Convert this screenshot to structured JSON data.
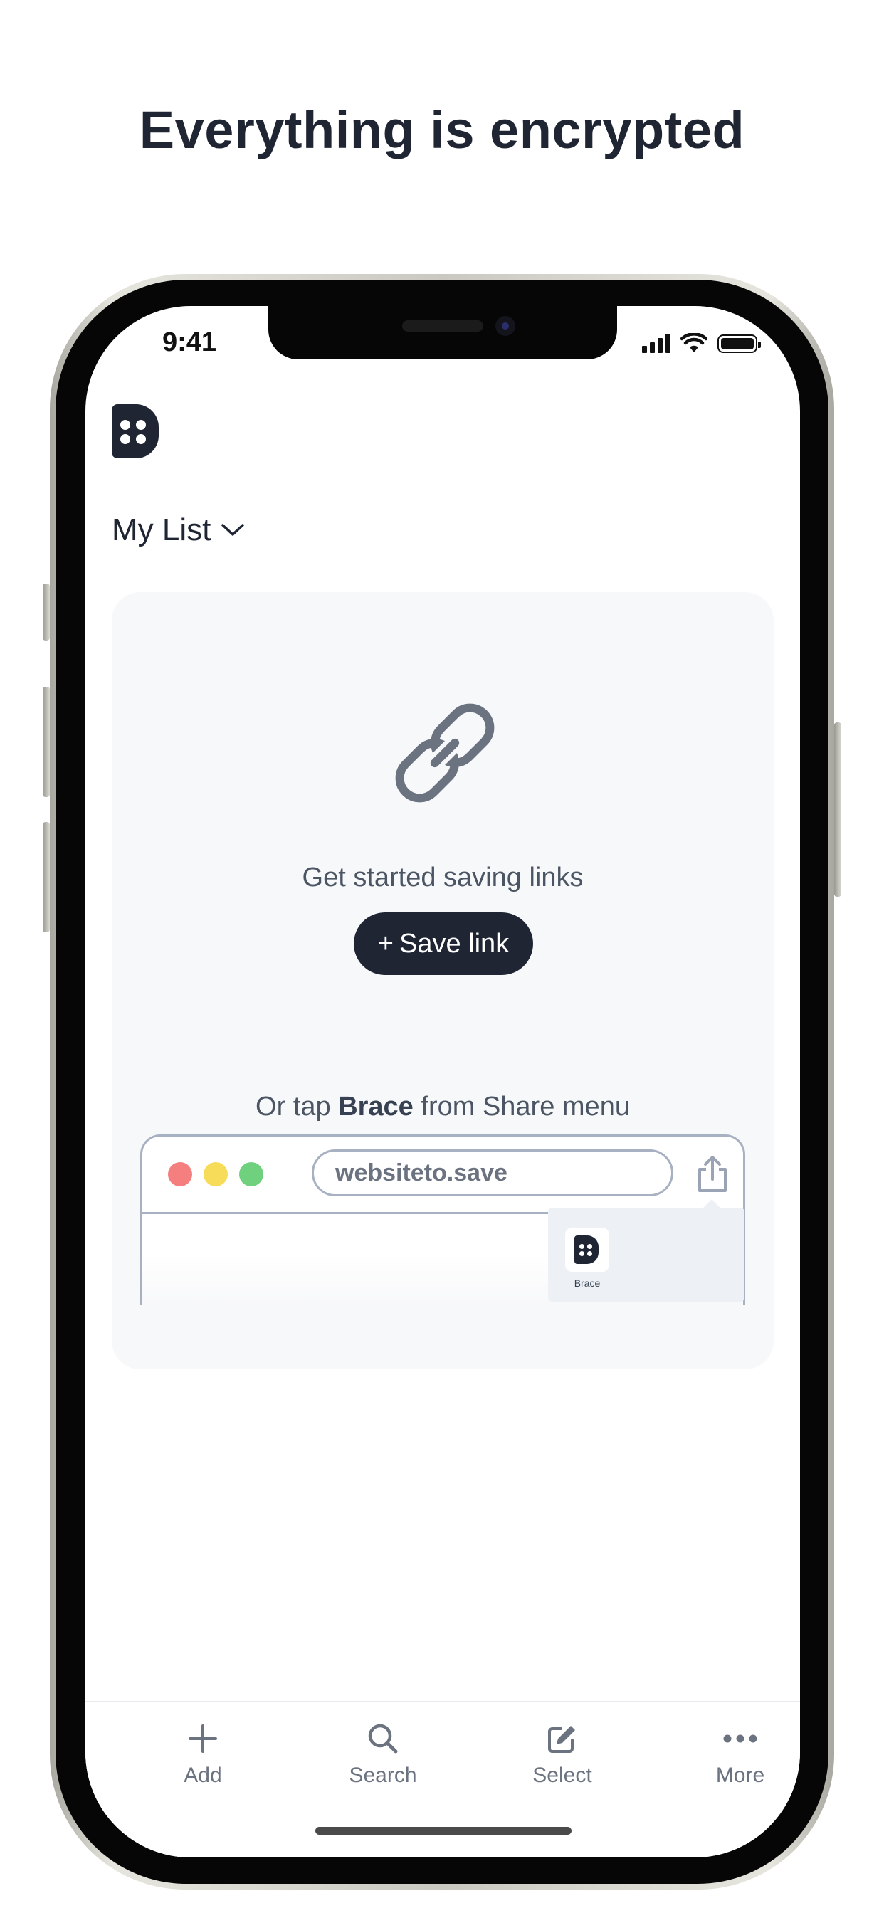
{
  "headline": "Everything is encrypted",
  "status_bar": {
    "time": "9:41"
  },
  "app": {
    "logo_icon": "brace-logo-icon"
  },
  "list_selector": {
    "label": "My List",
    "icon": "chevron-down-icon"
  },
  "empty_state": {
    "icon": "link-icon",
    "prompt": "Get started saving links",
    "save_button": {
      "plus": "+",
      "label": "Save link"
    },
    "share_hint": {
      "before": "Or tap ",
      "app_name": "Brace",
      "after": " from Share menu"
    }
  },
  "browser_illustration": {
    "url": "websiteto.save",
    "traffic_light_colors": [
      "#f57f7f",
      "#f7dc5a",
      "#6fd17d"
    ],
    "share_app_label": "Brace"
  },
  "tabbar": {
    "items": [
      {
        "label": "Add",
        "icon": "plus-icon"
      },
      {
        "label": "Search",
        "icon": "search-icon"
      },
      {
        "label": "Select",
        "icon": "edit-icon"
      },
      {
        "label": "More",
        "icon": "more-icon"
      }
    ]
  },
  "colors": {
    "primary": "#1f2533",
    "muted_text": "#6b7280",
    "card_bg": "#f7f8fa",
    "outline": "#a7b1c2"
  }
}
